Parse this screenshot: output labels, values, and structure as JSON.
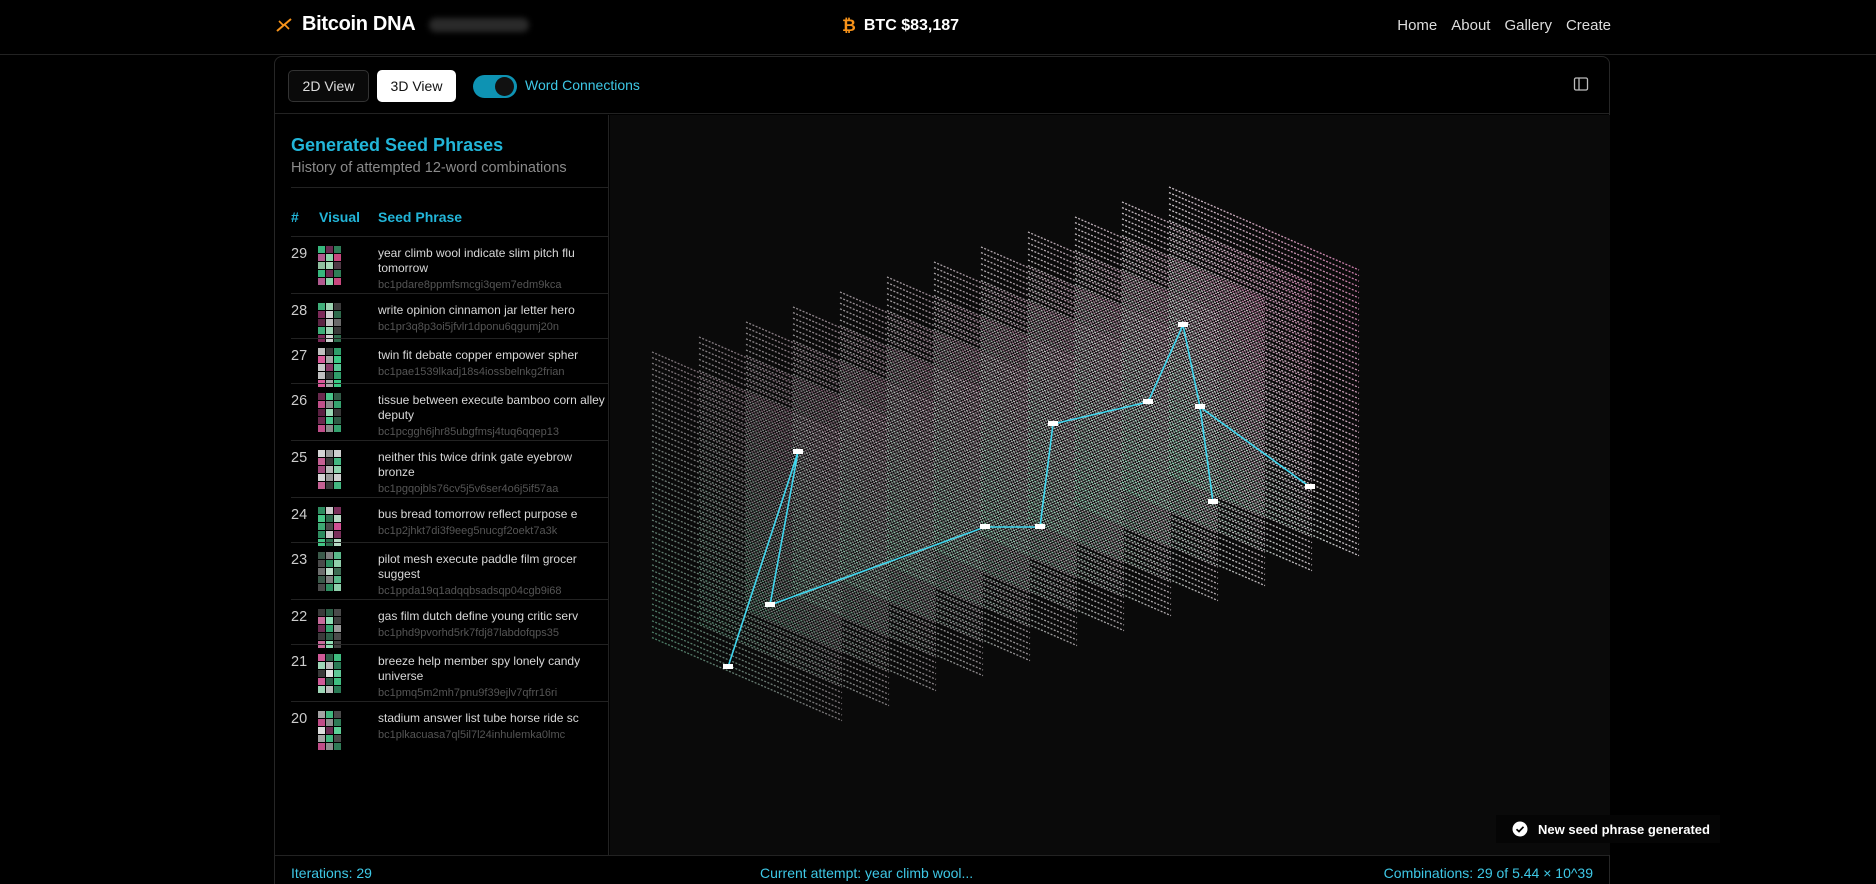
{
  "header": {
    "brand": "Bitcoin DNA",
    "price_label": "BTC $83,187",
    "nav": [
      "Home",
      "About",
      "Gallery",
      "Create"
    ]
  },
  "toolbar": {
    "view_2d": "2D View",
    "view_3d": "3D View",
    "word_connections_label": "Word Connections",
    "word_connections_on": true
  },
  "left_panel": {
    "title": "Generated Seed Phrases",
    "subtitle": "History of attempted 12-word combinations",
    "columns": [
      "#",
      "Visual",
      "Seed Phrase"
    ],
    "rows": [
      {
        "num": "29",
        "phrase": "year climb wool indicate slim pitch flu tomorrow",
        "address": "bc1pdare8ppmfsmcgi3qem7edm9kca",
        "colors": [
          "#37b77d",
          "#6b2a52",
          "#2f7d57",
          "#b05a8f",
          "#8ad4aa",
          "#c9487f",
          "#8fbf9f",
          "#a7d9b8",
          "#4f3a46"
        ]
      },
      {
        "num": "28",
        "phrase": "write opinion cinnamon jar letter hero",
        "address": "bc1pr3q8p3oi5jfvlr1dponu6qgumj20n",
        "colors": [
          "#3fae79",
          "#9dd3b2",
          "#3a3a3a",
          "#7c2a59",
          "#cfcfcf",
          "#2e6b4c",
          "#5c2444",
          "#bdbdbd",
          "#6a6a6a"
        ]
      },
      {
        "num": "27",
        "phrase": "twin fit debate copper empower spher",
        "address": "bc1pae1539lkadj18s4iossbelnkg2frian",
        "colors": [
          "#c0c0c0",
          "#3b3b3b",
          "#2f9e6a",
          "#d85a9a",
          "#a7a7a7",
          "#3ccb86",
          "#c7c7c7",
          "#8a3a68",
          "#57c895"
        ]
      },
      {
        "num": "26",
        "phrase": "tissue between execute bamboo corn alley deputy",
        "address": "bc1pcggh6jhr85ubgfmsj4tuq6qqep13",
        "colors": [
          "#6a2a4f",
          "#49c58a",
          "#2f5a45",
          "#c04f8a",
          "#8b8b8b",
          "#35a36f",
          "#5b2042",
          "#9ad5b3",
          "#383838"
        ]
      },
      {
        "num": "25",
        "phrase": "neither this twice drink gate eyebrow bronze",
        "address": "bc1pgqojbls76cv5j5v6ser4o6j5if57aa",
        "colors": [
          "#d4d4d4",
          "#9a9a9a",
          "#cfcfcf",
          "#c46093",
          "#3a3a3a",
          "#43b781",
          "#a04b7d",
          "#b8b8b8",
          "#8fd3ae"
        ]
      },
      {
        "num": "24",
        "phrase": "bus bread tomorrow reflect purpose e",
        "address": "bc1p2jhkt7di3f9eeg5nucgf2oekt7a3k",
        "colors": [
          "#2e8b5f",
          "#c9c9c9",
          "#7a2f5b",
          "#45c485",
          "#2f6e4f",
          "#b6d8c4",
          "#3ea873",
          "#4b4b4b",
          "#d14f93"
        ]
      },
      {
        "num": "23",
        "phrase": "pilot mesh execute paddle film grocer suggest",
        "address": "bc1ppda19q1adqqbsadsqp04cgb9i68",
        "colors": [
          "#3b5a4a",
          "#7e7e7e",
          "#5ab88a",
          "#4a4a4a",
          "#2f8f61",
          "#8fcfab",
          "#6e6e6e",
          "#bcdcc9",
          "#3d6b53"
        ]
      },
      {
        "num": "22",
        "phrase": "gas film dutch define young critic serv",
        "address": "bc1phd9pvorhd5rk7fdj87labdofqps35",
        "colors": [
          "#3a3a3a",
          "#2e5f47",
          "#4a4a4a",
          "#c66a9a",
          "#8fdcb4",
          "#404040",
          "#6b2c52",
          "#35a570",
          "#9a9a9a"
        ]
      },
      {
        "num": "21",
        "phrase": "breeze help member spy lonely candy universe",
        "address": "bc1pmq5m2mh7pnu9f39ejlv7qfrr16ri",
        "colors": [
          "#d05a98",
          "#2f5e49",
          "#3fbd80",
          "#9fd6b7",
          "#bcbcbc",
          "#2a7a55",
          "#3a3a3a",
          "#e0e0e0",
          "#5fc797"
        ]
      },
      {
        "num": "20",
        "phrase": "stadium answer list tube horse ride sc",
        "address": "bc1plkacuasa7ql5il7l24inhulemka0lmc",
        "colors": [
          "#a3a3a3",
          "#41b67e",
          "#4a4a4a",
          "#c04d88",
          "#8f8f8f",
          "#2f7a56",
          "#dcdcdc",
          "#6b2b52",
          "#5ccf96"
        ]
      }
    ]
  },
  "footer": {
    "iterations": "Iterations: 29",
    "current_attempt": "Current attempt: year climb wool...",
    "combinations": "Combinations: 29 of 5.44 × 10^39"
  },
  "toast": {
    "message": "New seed phrase generated"
  },
  "colors": {
    "accent": "#22b5d8",
    "toggle": "#0e93b3",
    "bitcoin": "#f7931a",
    "link_line": "#3fd6ef"
  }
}
